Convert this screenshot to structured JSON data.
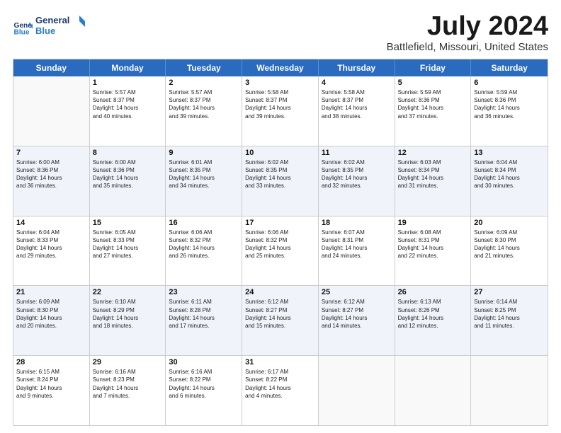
{
  "header": {
    "logo_line1": "General",
    "logo_line2": "Blue",
    "title": "July 2024",
    "subtitle": "Battlefield, Missouri, United States"
  },
  "calendar": {
    "days_of_week": [
      "Sunday",
      "Monday",
      "Tuesday",
      "Wednesday",
      "Thursday",
      "Friday",
      "Saturday"
    ],
    "rows": [
      [
        {
          "day": "",
          "sunrise": "",
          "sunset": "",
          "daylight": "",
          "empty": true
        },
        {
          "day": "1",
          "sunrise": "Sunrise: 5:57 AM",
          "sunset": "Sunset: 8:37 PM",
          "daylight": "Daylight: 14 hours and 40 minutes."
        },
        {
          "day": "2",
          "sunrise": "Sunrise: 5:57 AM",
          "sunset": "Sunset: 8:37 PM",
          "daylight": "Daylight: 14 hours and 39 minutes."
        },
        {
          "day": "3",
          "sunrise": "Sunrise: 5:58 AM",
          "sunset": "Sunset: 8:37 PM",
          "daylight": "Daylight: 14 hours and 39 minutes."
        },
        {
          "day": "4",
          "sunrise": "Sunrise: 5:58 AM",
          "sunset": "Sunset: 8:37 PM",
          "daylight": "Daylight: 14 hours and 38 minutes."
        },
        {
          "day": "5",
          "sunrise": "Sunrise: 5:59 AM",
          "sunset": "Sunset: 8:36 PM",
          "daylight": "Daylight: 14 hours and 37 minutes."
        },
        {
          "day": "6",
          "sunrise": "Sunrise: 5:59 AM",
          "sunset": "Sunset: 8:36 PM",
          "daylight": "Daylight: 14 hours and 36 minutes."
        }
      ],
      [
        {
          "day": "7",
          "sunrise": "Sunrise: 6:00 AM",
          "sunset": "Sunset: 8:36 PM",
          "daylight": "Daylight: 14 hours and 36 minutes."
        },
        {
          "day": "8",
          "sunrise": "Sunrise: 6:00 AM",
          "sunset": "Sunset: 8:36 PM",
          "daylight": "Daylight: 14 hours and 35 minutes."
        },
        {
          "day": "9",
          "sunrise": "Sunrise: 6:01 AM",
          "sunset": "Sunset: 8:35 PM",
          "daylight": "Daylight: 14 hours and 34 minutes."
        },
        {
          "day": "10",
          "sunrise": "Sunrise: 6:02 AM",
          "sunset": "Sunset: 8:35 PM",
          "daylight": "Daylight: 14 hours and 33 minutes."
        },
        {
          "day": "11",
          "sunrise": "Sunrise: 6:02 AM",
          "sunset": "Sunset: 8:35 PM",
          "daylight": "Daylight: 14 hours and 32 minutes."
        },
        {
          "day": "12",
          "sunrise": "Sunrise: 6:03 AM",
          "sunset": "Sunset: 8:34 PM",
          "daylight": "Daylight: 14 hours and 31 minutes."
        },
        {
          "day": "13",
          "sunrise": "Sunrise: 6:04 AM",
          "sunset": "Sunset: 8:34 PM",
          "daylight": "Daylight: 14 hours and 30 minutes."
        }
      ],
      [
        {
          "day": "14",
          "sunrise": "Sunrise: 6:04 AM",
          "sunset": "Sunset: 8:33 PM",
          "daylight": "Daylight: 14 hours and 29 minutes."
        },
        {
          "day": "15",
          "sunrise": "Sunrise: 6:05 AM",
          "sunset": "Sunset: 8:33 PM",
          "daylight": "Daylight: 14 hours and 27 minutes."
        },
        {
          "day": "16",
          "sunrise": "Sunrise: 6:06 AM",
          "sunset": "Sunset: 8:32 PM",
          "daylight": "Daylight: 14 hours and 26 minutes."
        },
        {
          "day": "17",
          "sunrise": "Sunrise: 6:06 AM",
          "sunset": "Sunset: 8:32 PM",
          "daylight": "Daylight: 14 hours and 25 minutes."
        },
        {
          "day": "18",
          "sunrise": "Sunrise: 6:07 AM",
          "sunset": "Sunset: 8:31 PM",
          "daylight": "Daylight: 14 hours and 24 minutes."
        },
        {
          "day": "19",
          "sunrise": "Sunrise: 6:08 AM",
          "sunset": "Sunset: 8:31 PM",
          "daylight": "Daylight: 14 hours and 22 minutes."
        },
        {
          "day": "20",
          "sunrise": "Sunrise: 6:09 AM",
          "sunset": "Sunset: 8:30 PM",
          "daylight": "Daylight: 14 hours and 21 minutes."
        }
      ],
      [
        {
          "day": "21",
          "sunrise": "Sunrise: 6:09 AM",
          "sunset": "Sunset: 8:30 PM",
          "daylight": "Daylight: 14 hours and 20 minutes."
        },
        {
          "day": "22",
          "sunrise": "Sunrise: 6:10 AM",
          "sunset": "Sunset: 8:29 PM",
          "daylight": "Daylight: 14 hours and 18 minutes."
        },
        {
          "day": "23",
          "sunrise": "Sunrise: 6:11 AM",
          "sunset": "Sunset: 8:28 PM",
          "daylight": "Daylight: 14 hours and 17 minutes."
        },
        {
          "day": "24",
          "sunrise": "Sunrise: 6:12 AM",
          "sunset": "Sunset: 8:27 PM",
          "daylight": "Daylight: 14 hours and 15 minutes."
        },
        {
          "day": "25",
          "sunrise": "Sunrise: 6:12 AM",
          "sunset": "Sunset: 8:27 PM",
          "daylight": "Daylight: 14 hours and 14 minutes."
        },
        {
          "day": "26",
          "sunrise": "Sunrise: 6:13 AM",
          "sunset": "Sunset: 8:26 PM",
          "daylight": "Daylight: 14 hours and 12 minutes."
        },
        {
          "day": "27",
          "sunrise": "Sunrise: 6:14 AM",
          "sunset": "Sunset: 8:25 PM",
          "daylight": "Daylight: 14 hours and 11 minutes."
        }
      ],
      [
        {
          "day": "28",
          "sunrise": "Sunrise: 6:15 AM",
          "sunset": "Sunset: 8:24 PM",
          "daylight": "Daylight: 14 hours and 9 minutes."
        },
        {
          "day": "29",
          "sunrise": "Sunrise: 6:16 AM",
          "sunset": "Sunset: 8:23 PM",
          "daylight": "Daylight: 14 hours and 7 minutes."
        },
        {
          "day": "30",
          "sunrise": "Sunrise: 6:16 AM",
          "sunset": "Sunset: 8:22 PM",
          "daylight": "Daylight: 14 hours and 6 minutes."
        },
        {
          "day": "31",
          "sunrise": "Sunrise: 6:17 AM",
          "sunset": "Sunset: 8:22 PM",
          "daylight": "Daylight: 14 hours and 4 minutes."
        },
        {
          "day": "",
          "sunrise": "",
          "sunset": "",
          "daylight": "",
          "empty": true
        },
        {
          "day": "",
          "sunrise": "",
          "sunset": "",
          "daylight": "",
          "empty": true
        },
        {
          "day": "",
          "sunrise": "",
          "sunset": "",
          "daylight": "",
          "empty": true
        }
      ]
    ]
  }
}
